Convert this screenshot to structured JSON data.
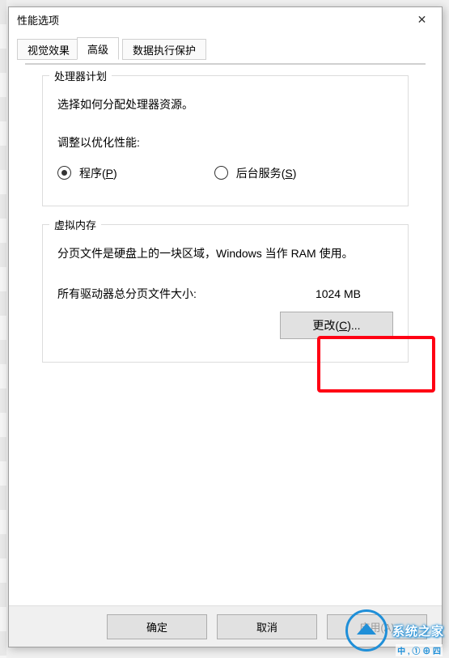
{
  "window": {
    "title": "性能选项"
  },
  "tabs": {
    "visual": "视觉效果",
    "advanced": "高级",
    "dep": "数据执行保护"
  },
  "cpu": {
    "legend": "处理器计划",
    "desc": "选择如何分配处理器资源。",
    "adjust_label": "调整以优化性能:",
    "programs": "程序",
    "programs_key": "P",
    "services": "后台服务",
    "services_key": "S"
  },
  "vm": {
    "legend": "虚拟内存",
    "desc": "分页文件是硬盘上的一块区域，Windows 当作 RAM 使用。",
    "total_label": "所有驱动器总分页文件大小:",
    "total_value": "1024 MB",
    "change_label": "更改",
    "change_key": "C"
  },
  "buttons": {
    "ok": "确定",
    "cancel": "取消",
    "apply": "应用(A)"
  },
  "watermark": {
    "brand": "系统之家",
    "sub": "中 , ① ⊕ 四"
  }
}
